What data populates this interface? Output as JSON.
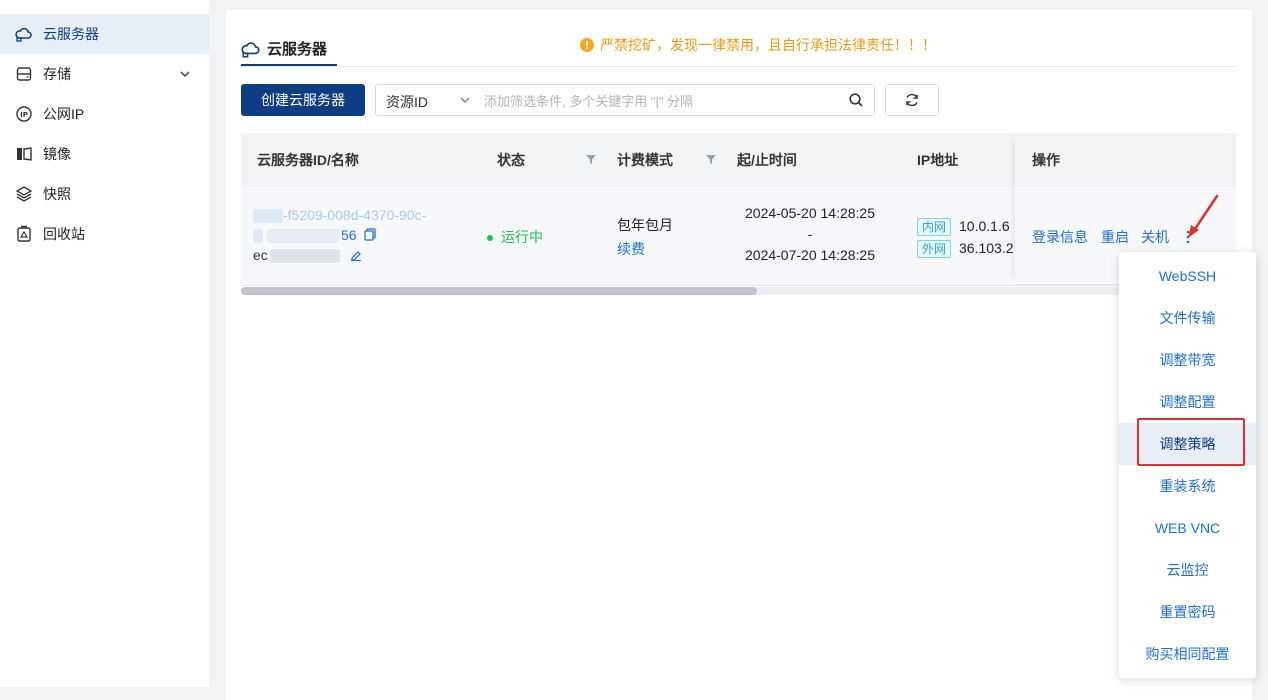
{
  "sidebar": {
    "items": [
      {
        "label": "云服务器",
        "icon": "cloud-server-icon",
        "active": true
      },
      {
        "label": "存储",
        "icon": "storage-icon",
        "expandable": true
      },
      {
        "label": "公网IP",
        "icon": "ip-icon"
      },
      {
        "label": "镜像",
        "icon": "image-icon"
      },
      {
        "label": "快照",
        "icon": "snapshot-icon"
      },
      {
        "label": "回收站",
        "icon": "recycle-bin-icon"
      }
    ]
  },
  "header": {
    "tab_label": "云服务器",
    "warning": "严禁挖矿，发现一律禁用，且自行承担法律责任！！！"
  },
  "toolbar": {
    "create_label": "创建云服务器",
    "filter_select": "资源ID",
    "filter_placeholder": "添加筛选条件, 多个关键字用 \"|\" 分隔"
  },
  "table": {
    "columns": [
      "云服务器ID/名称",
      "状态",
      "计费模式",
      "起/止时间",
      "IP地址",
      "操作"
    ],
    "rows": [
      {
        "id_line1": "-f5209-008d-4370-90c-",
        "id_line2_suffix": "56",
        "name_prefix": "ec",
        "status": "运行中",
        "billing": "包年包月",
        "renew": "续费",
        "start": "2024-05-20 14:28:25",
        "sep": "-",
        "end": "2024-07-20 14:28:25",
        "ip_private_tag": "内网",
        "ip_private": "10.0.1.6",
        "ip_public_tag": "外网",
        "ip_public": "36.103.2",
        "actions": [
          "登录信息",
          "重启",
          "关机"
        ]
      }
    ]
  },
  "more_menu": {
    "items": [
      "WebSSH",
      "文件传输",
      "调整带宽",
      "调整配置",
      "调整策略",
      "重装系统",
      "WEB VNC",
      "云监控",
      "重置密码",
      "购买相同配置"
    ],
    "highlighted_index": 4
  },
  "colors": {
    "primary": "#0f3d82",
    "link": "#1f6fd1",
    "warning": "#e89a16",
    "running": "#1fbf4c",
    "annotation": "#e0302b"
  }
}
